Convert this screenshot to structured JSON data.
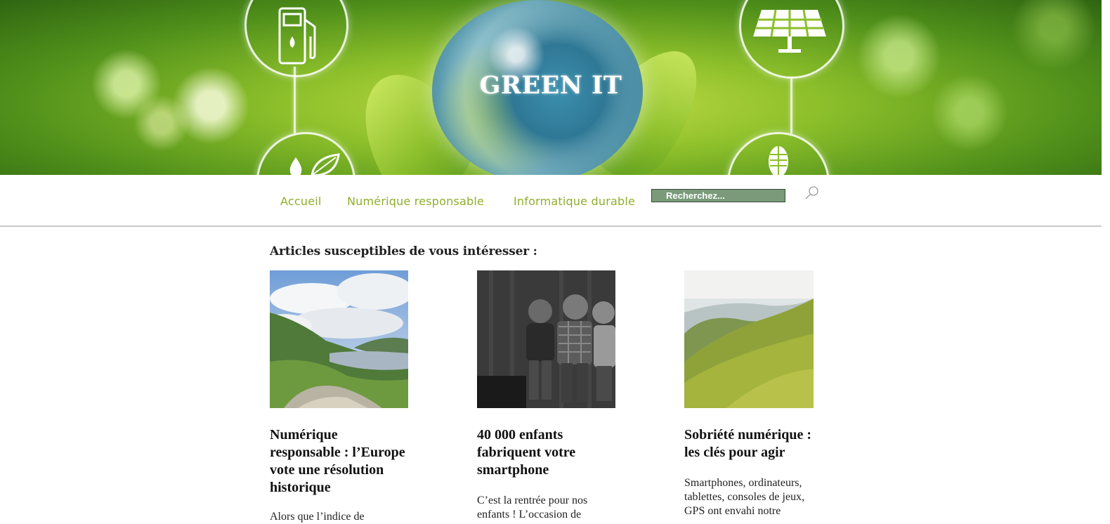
{
  "site": {
    "title": "GREEN IT"
  },
  "nav": {
    "items": [
      {
        "label": "Accueil"
      },
      {
        "label": "Numérique responsable"
      },
      {
        "label": "Informatique durable"
      }
    ],
    "search_placeholder": "Recherchez..."
  },
  "main": {
    "section_heading": "Articles susceptibles de vous intéresser :",
    "articles": [
      {
        "title": "Numérique responsable : l’Europe vote une résolution historique",
        "excerpt": "Alors que l’indice de",
        "image": "lake-valley-landscape"
      },
      {
        "title": "40 000 enfants fabriquent votre smartphone",
        "excerpt": "C’est la rentrée pour nos enfants ! L’occasion de",
        "image": "children-black-white-photo"
      },
      {
        "title": "Sobriété numérique : les clés pour agir",
        "excerpt": "Smartphones, ordinateurs, tablettes, consoles de jeux, GPS ont envahi notre",
        "image": "green-mountain-hills"
      }
    ]
  },
  "colors": {
    "nav_link": "#8fae2c",
    "search_bg": "#7a9a7a"
  },
  "icons": [
    "fuel-pump-icon",
    "solar-panel-icon",
    "water-drop-icon",
    "leaf-icon",
    "wheat-icon",
    "search-icon"
  ]
}
